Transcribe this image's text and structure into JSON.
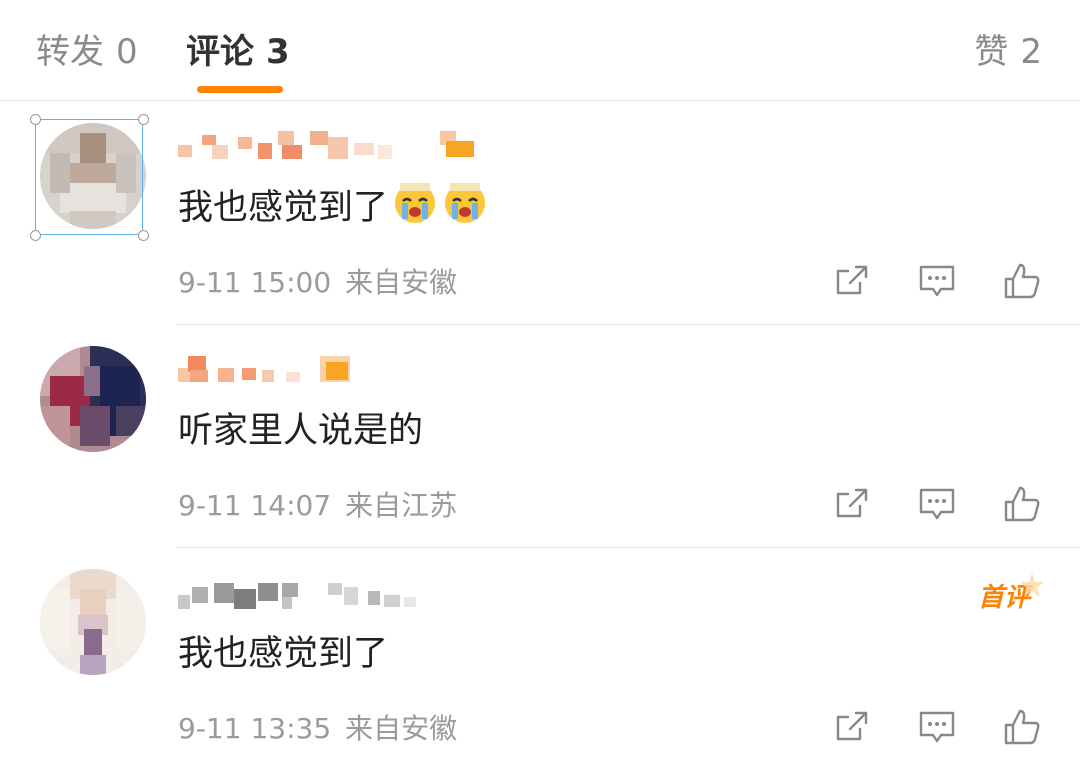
{
  "tabs": [
    {
      "label": "转发",
      "count": "0"
    },
    {
      "label": "评论",
      "count": "3"
    },
    {
      "label": "赞",
      "count": "2"
    }
  ],
  "colors": {
    "accent": "#ff8200",
    "meta": "#9b9b9b",
    "text": "#222222",
    "selection": "#5ab3f0"
  },
  "comments": [
    {
      "text": "我也感觉到了",
      "emojis": [
        "crying-face-emoji",
        "crying-face-emoji"
      ],
      "time": "9-11 15:00",
      "location": "来自安徽",
      "badge": ""
    },
    {
      "text": "听家里人说是的",
      "emojis": [],
      "time": "9-11 14:07",
      "location": "来自江苏",
      "badge": ""
    },
    {
      "text": "我也感觉到了",
      "emojis": [],
      "time": "9-11 13:35",
      "location": "来自安徽",
      "badge": "首评"
    }
  ],
  "icons": {
    "share": "share-icon",
    "reply": "comment-icon",
    "like": "thumbs-up-icon"
  }
}
